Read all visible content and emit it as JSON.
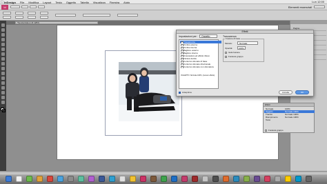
{
  "menubar": {
    "apple": "",
    "items": [
      "InDesign",
      "File",
      "Modifica",
      "Layout",
      "Testo",
      "Oggetto",
      "Tabella",
      "Visualizza",
      "Finestra",
      "Aiuto"
    ],
    "right_status": "Lun 12:00"
  },
  "appbar": {
    "workspace": "Elementi essenziali"
  },
  "document_tab": {
    "label": "*Senza titolo-1 @ 125%"
  },
  "effects_dialog": {
    "title": "Effetti",
    "settings_for_label": "Impostazioni per:",
    "settings_for_value": "Oggetto",
    "effects": [
      "Trasparenza",
      "Ombra esterna",
      "Ombra interna",
      "Bagliore esterno",
      "Bagliore interno",
      "Smussatura ed effetto rilievo",
      "Finitura lucida",
      "Contorno sfumato di base",
      "Contorno sfumato direzionale",
      "Contorno sfumato con sfumatura"
    ],
    "selected_effect": "Trasparenza",
    "summary_text": "OGGETTO: Normale 100%; (nessun effetto)",
    "options_title": "Trasparenza",
    "group_title": "Fusione di base",
    "mode_label": "Metodo:",
    "mode_value": "Normale",
    "opacity_label": "Opacità:",
    "opacity_value": "100%",
    "isolate_label": "Isola fusione",
    "knockout_label": "Foratura gruppo",
    "preview_label": "Anteprima",
    "cancel_label": "Annulla",
    "ok_label": "OK"
  },
  "effects_panel": {
    "tab": "Effetti",
    "rows": [
      {
        "label": "Normale",
        "value": "100%"
      },
      {
        "label": "Oggetto",
        "value": "Normale 100%"
      },
      {
        "label": "Traccia",
        "value": "Normale 100%"
      },
      {
        "label": "Riempimento",
        "value": "Normale 100%"
      },
      {
        "label": "Testo",
        "value": ""
      }
    ],
    "knockout_label": "Foratura gruppo"
  },
  "right_panel": {
    "items": [
      "Pagine",
      "Livelli",
      "Collegamenti",
      "Traccia",
      "Colore",
      "Campioni",
      "Effetti"
    ]
  },
  "colors": {
    "selection": "#3a78d8",
    "ok_button": "#5c98e6"
  }
}
